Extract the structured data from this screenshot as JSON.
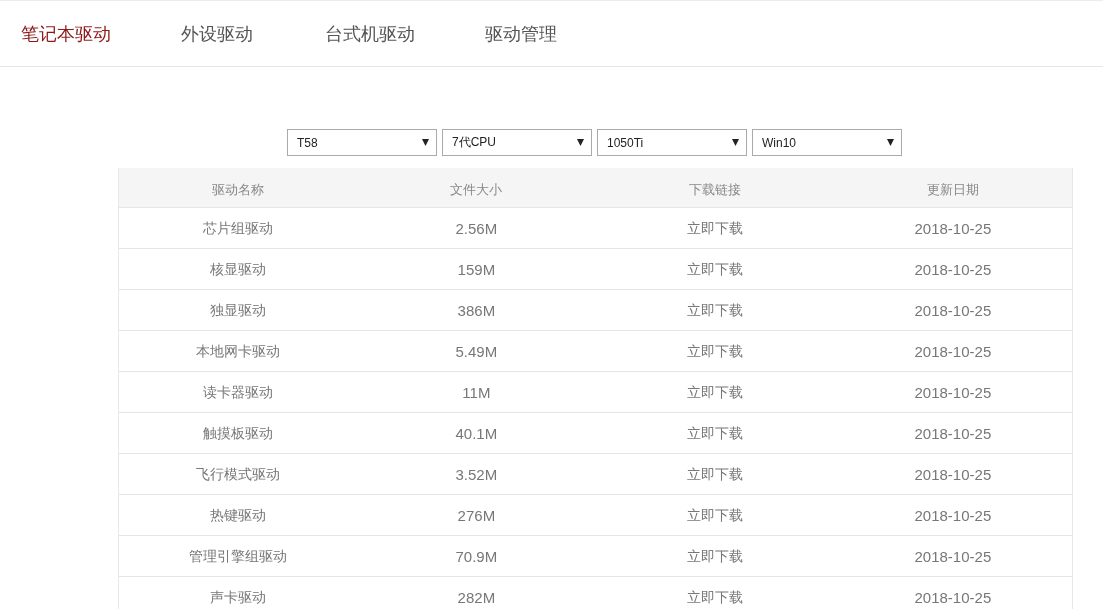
{
  "tabs": [
    {
      "label": "笔记本驱动",
      "selected": true
    },
    {
      "label": "外设驱动",
      "selected": false
    },
    {
      "label": "台式机驱动",
      "selected": false
    },
    {
      "label": "驱动管理",
      "selected": false
    }
  ],
  "filters": [
    {
      "value": "T58"
    },
    {
      "value": "7代CPU"
    },
    {
      "value": "1050Ti"
    },
    {
      "value": "Win10"
    }
  ],
  "table": {
    "columns": [
      "驱动名称",
      "文件大小",
      "下载链接",
      "更新日期"
    ],
    "rows": [
      {
        "name": "芯片组驱动",
        "size": "2.56M",
        "link": "立即下载",
        "date": "2018-10-25"
      },
      {
        "name": "核显驱动",
        "size": "159M",
        "link": "立即下载",
        "date": "2018-10-25"
      },
      {
        "name": "独显驱动",
        "size": "386M",
        "link": "立即下载",
        "date": "2018-10-25"
      },
      {
        "name": "本地网卡驱动",
        "size": "5.49M",
        "link": "立即下载",
        "date": "2018-10-25"
      },
      {
        "name": "读卡器驱动",
        "size": "11M",
        "link": "立即下载",
        "date": "2018-10-25"
      },
      {
        "name": "触摸板驱动",
        "size": "40.1M",
        "link": "立即下载",
        "date": "2018-10-25"
      },
      {
        "name": "飞行模式驱动",
        "size": "3.52M",
        "link": "立即下载",
        "date": "2018-10-25"
      },
      {
        "name": "热键驱动",
        "size": "276M",
        "link": "立即下载",
        "date": "2018-10-25"
      },
      {
        "name": "管理引擎组驱动",
        "size": "70.9M",
        "link": "立即下载",
        "date": "2018-10-25"
      },
      {
        "name": "声卡驱动",
        "size": "282M",
        "link": "立即下载",
        "date": "2018-10-25"
      }
    ]
  }
}
